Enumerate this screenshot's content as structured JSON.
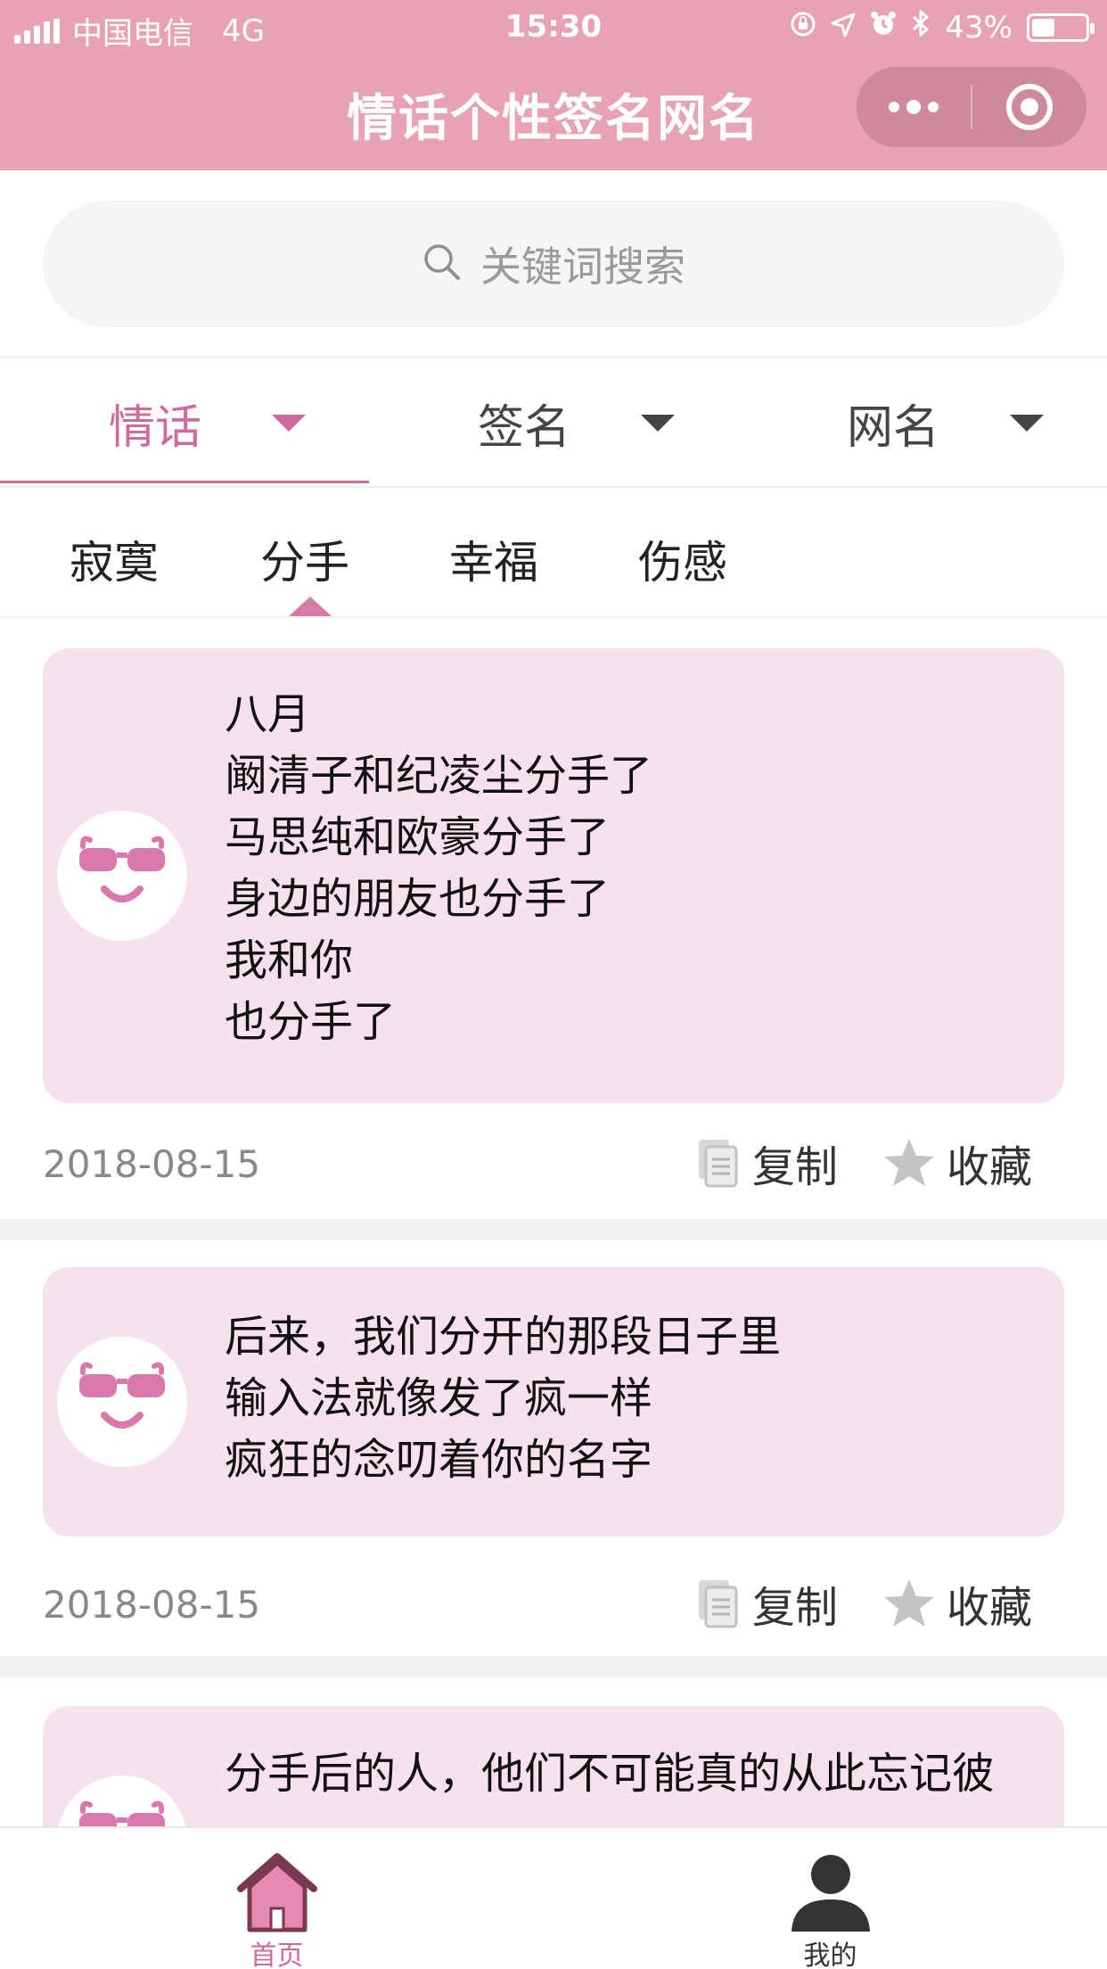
{
  "status_bar": {
    "carrier": "中国电信",
    "network": "4G",
    "time": "15:30",
    "battery": "43%",
    "battery_level": 0.43
  },
  "nav": {
    "title": "情话个性签名网名"
  },
  "search": {
    "placeholder": "关键词搜索"
  },
  "categories": [
    {
      "label": "情话",
      "active": true
    },
    {
      "label": "签名",
      "active": false
    },
    {
      "label": "网名",
      "active": false
    }
  ],
  "subcategories": [
    {
      "label": "寂寞",
      "active": false
    },
    {
      "label": "分手",
      "active": true
    },
    {
      "label": "幸福",
      "active": false
    },
    {
      "label": "伤感",
      "active": false
    }
  ],
  "posts": [
    {
      "lines": [
        "八月",
        "阚清子和纪凌尘分手了",
        "马思纯和欧豪分手了",
        "身边的朋友也分手了",
        "我和你",
        "也分手了"
      ],
      "date": "2018-08-15",
      "copy_label": "复制",
      "fav_label": "收藏"
    },
    {
      "lines": [
        "后来，我们分开的那段日子里",
        "输入法就像发了疯一样",
        "疯狂的念叨着你的名字"
      ],
      "date": "2018-08-15",
      "copy_label": "复制",
      "fav_label": "收藏"
    },
    {
      "lines": [
        "分手后的人，他们不可能真的从此忘记彼"
      ],
      "date": "",
      "copy_label": "",
      "fav_label": ""
    }
  ],
  "tabbar": {
    "home_label": "首页",
    "mine_label": "我的"
  },
  "colors": {
    "header_bg": "#e7a3b3",
    "accent": "#d06a9a",
    "bubble_bg": "#f6e1ec",
    "icon_gray": "#b5b5b5"
  }
}
